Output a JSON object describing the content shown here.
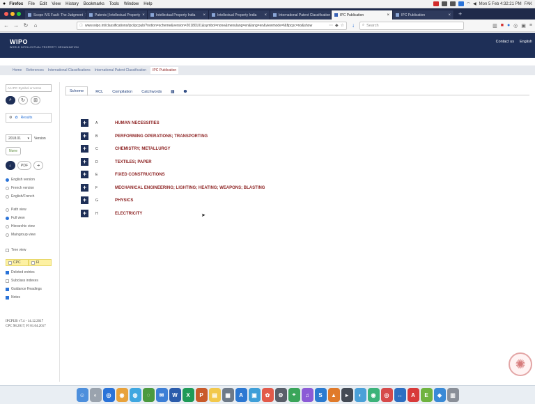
{
  "menubar": {
    "apple": "",
    "items": [
      "Firefox",
      "File",
      "Edit",
      "View",
      "History",
      "Bookmarks",
      "Tools",
      "Window",
      "Help"
    ],
    "clock": "Mon 5 Feb 4:32:21 PM",
    "user": "FAK"
  },
  "browser": {
    "tabs": [
      {
        "label": "Scope IVS Fault- The Judgment"
      },
      {
        "label": "Patents | Intellectual Property"
      },
      {
        "label": "Intellectual Property India"
      },
      {
        "label": "Intellectual Property India"
      },
      {
        "label": "International Patent Classification"
      },
      {
        "label": "IPC Publication"
      },
      {
        "label": "IPC Publication"
      }
    ],
    "new_tab": "+",
    "url": "www.wipo.int/classifications/ipc/ipcpub/?notion=scheme&version=20180101&symbol=none&menulang=en&lang=en&viewmode=f&fipcpc=no&show",
    "search_placeholder": "Search"
  },
  "header": {
    "logo": "WIPO",
    "org": "WORLD INTELLECTUAL PROPERTY ORGANIZATION",
    "contact": "Contact us",
    "lang": "English"
  },
  "breadcrumb": [
    "Home",
    "References",
    "International Classifications",
    "International Patent Classification",
    "IPC Publication"
  ],
  "sidebar": {
    "search_placeholder": "An IPC Symbol or terms",
    "results_label": "Results",
    "version_value": "2018.01",
    "version_label": "Version",
    "none_label": "None",
    "pdf_label": "PDF",
    "lang_options": [
      {
        "label": "English version",
        "on": true
      },
      {
        "label": "French version",
        "on": false
      },
      {
        "label": "English/French",
        "on": false
      }
    ],
    "view_options": [
      {
        "label": "Path view",
        "on": false
      },
      {
        "label": "Full view",
        "on": true
      },
      {
        "label": "Hierarchic view",
        "on": false
      },
      {
        "label": "Maingroup view",
        "on": false
      }
    ],
    "tree_view": "Tree view",
    "cpc": "CPC",
    "fi": "FI",
    "checks": [
      {
        "label": "Deleted entries",
        "on": true
      },
      {
        "label": "Subclass indexes",
        "on": false
      },
      {
        "label": "Guidance Headings",
        "on": true
      },
      {
        "label": "Notes",
        "on": true
      }
    ],
    "footer_line1": "IPCPUB v7.4 - 14.12.2017",
    "footer_line2": "CPC 98.2017; FI 01.04.2017"
  },
  "main": {
    "tabs": [
      "Scheme",
      "RCL",
      "Compilation",
      "Catchwords"
    ],
    "sections": [
      {
        "symbol": "A",
        "title": "HUMAN NECESSITIES"
      },
      {
        "symbol": "B",
        "title": "PERFORMING OPERATIONS; TRANSPORTING"
      },
      {
        "symbol": "C",
        "title": "CHEMISTRY; METALLURGY"
      },
      {
        "symbol": "D",
        "title": "TEXTILES; PAPER"
      },
      {
        "symbol": "E",
        "title": "FIXED CONSTRUCTIONS"
      },
      {
        "symbol": "F",
        "title": "MECHANICAL ENGINEERING; LIGHTING; HEATING; WEAPONS; BLASTING"
      },
      {
        "symbol": "G",
        "title": "PHYSICS"
      },
      {
        "symbol": "H",
        "title": "ELECTRICITY"
      }
    ]
  },
  "colors": {
    "wipo_navy": "#1e2f57",
    "section_red": "#8b1f1f",
    "link_blue": "#1e3d7a"
  }
}
